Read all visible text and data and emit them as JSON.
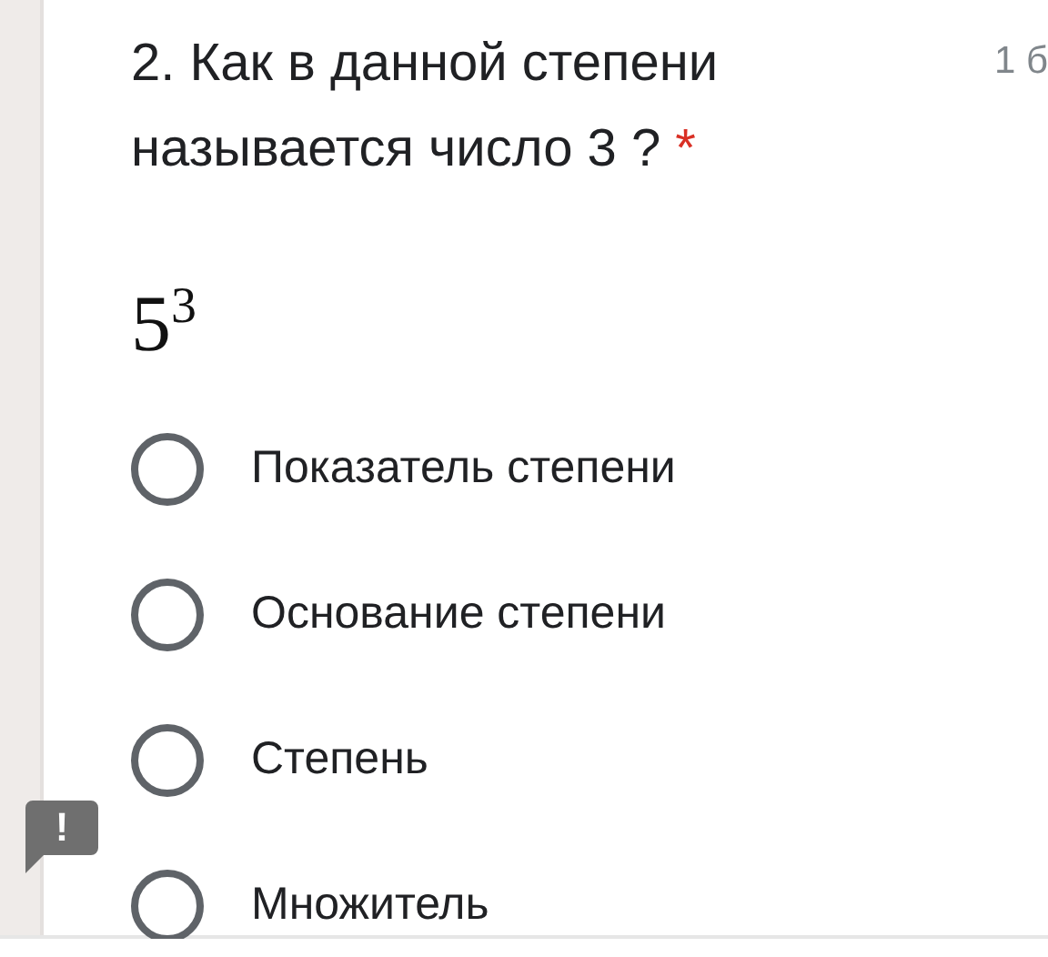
{
  "question": {
    "title": "2. Как в данной степени называется число 3 ?",
    "required_mark": "*",
    "points": "1 б",
    "expression": "5$^{3}$"
  },
  "options": [
    {
      "label": "Показатель степени",
      "selected": false
    },
    {
      "label": "Основание степени",
      "selected": false
    },
    {
      "label": "Степень",
      "selected": false
    },
    {
      "label": "Множитель",
      "selected": false
    }
  ],
  "report_badge": {
    "label": "!"
  }
}
